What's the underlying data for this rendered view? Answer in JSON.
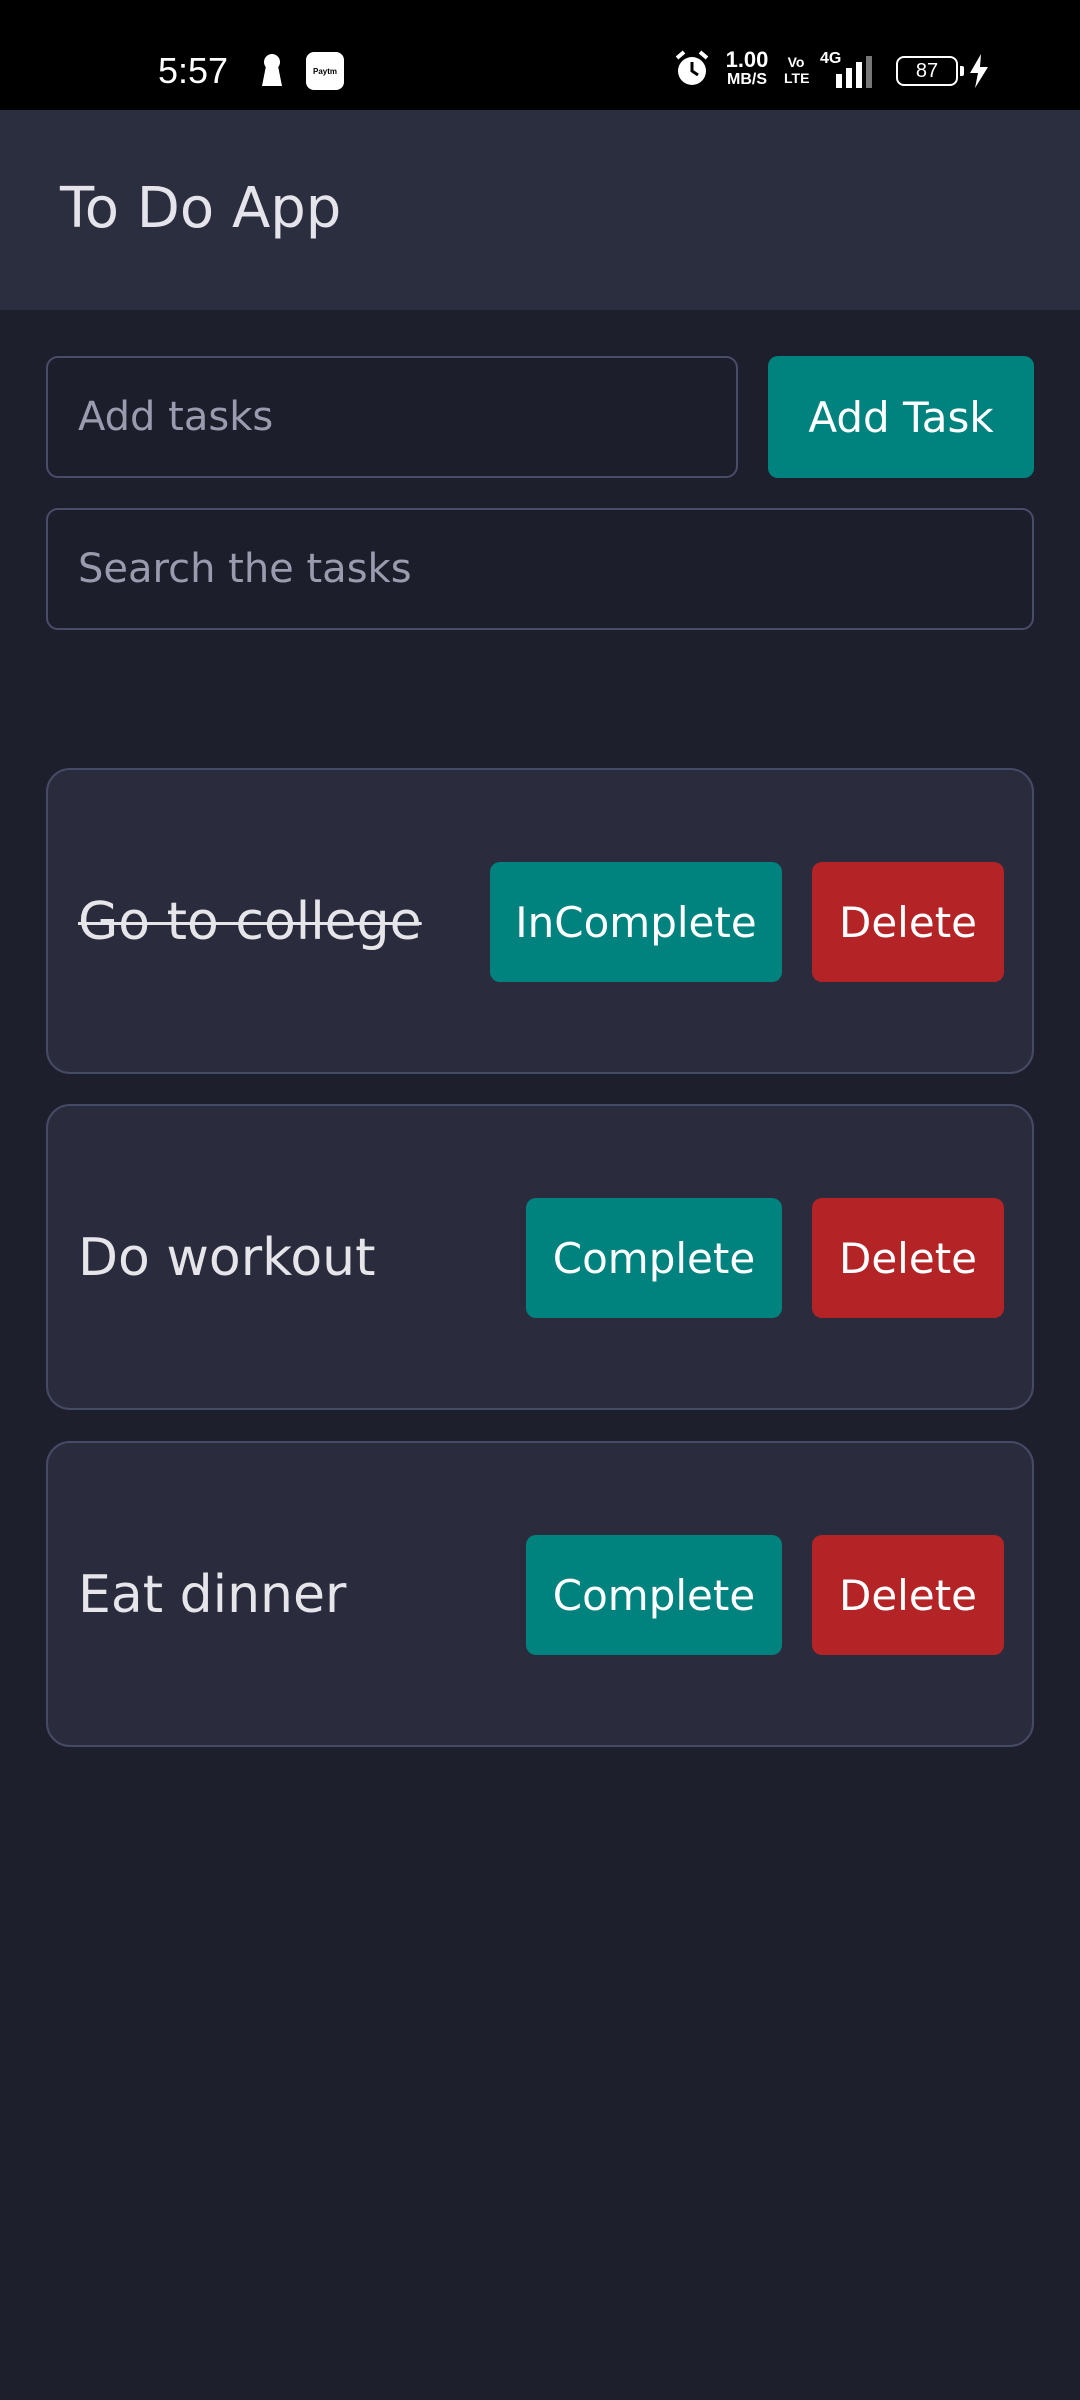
{
  "status_bar": {
    "time": "5:57",
    "paytm_label": "Paytm",
    "speed_value": "1.00",
    "speed_unit": "MB/S",
    "volte_top": "Vo",
    "volte_bottom": "LTE",
    "network": "4G",
    "battery": "87",
    "icons": [
      "keyhole-icon",
      "paytm-icon",
      "alarm-icon",
      "signal-icon",
      "battery-icon",
      "charging-bolt-icon"
    ]
  },
  "header": {
    "title": "To Do App"
  },
  "add_task": {
    "placeholder": "Add tasks",
    "value": "",
    "button_label": "Add Task"
  },
  "search": {
    "placeholder": "Search the tasks",
    "value": ""
  },
  "tasks": [
    {
      "text": "Go to college",
      "completed": true,
      "toggle_label": "InComplete",
      "delete_label": "Delete"
    },
    {
      "text": "Do workout",
      "completed": false,
      "toggle_label": "Complete",
      "delete_label": "Delete"
    },
    {
      "text": "Eat dinner",
      "completed": false,
      "toggle_label": "Complete",
      "delete_label": "Delete"
    }
  ],
  "colors": {
    "background": "#1d1f2c",
    "header": "#2b2e3f",
    "card": "#2a2c3e",
    "accent_teal": "#00837e",
    "danger_red": "#b42326"
  }
}
